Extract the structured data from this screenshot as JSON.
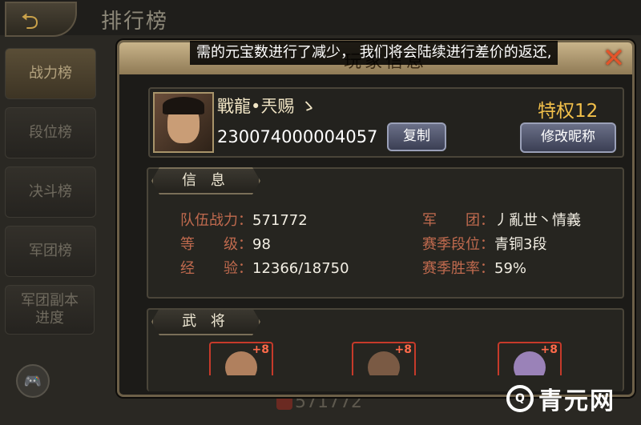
{
  "header": {
    "title": "排行榜"
  },
  "sidebar": {
    "tabs": [
      {
        "label": "战力榜"
      },
      {
        "label": "段位榜"
      },
      {
        "label": "决斗榜"
      },
      {
        "label": "军团榜"
      },
      {
        "label": "军团副本进度"
      }
    ]
  },
  "background": {
    "power_value": "571772"
  },
  "dialog": {
    "title": "玩家信息",
    "notice": "需的元宝数进行了减少， 我们将会陆续进行差价的返还,",
    "profile": {
      "name": "戰龍•兲赐 ゝ",
      "id": "230074000004057",
      "copy_label": "复制",
      "vip": "特权12",
      "rename_label": "修改昵称"
    },
    "info": {
      "section_label": "信 息",
      "rows": [
        {
          "label": "队伍战力",
          "value": "571772"
        },
        {
          "label": "等　　级",
          "value": "98"
        },
        {
          "label": "经　　验",
          "value": "12366/18750"
        },
        {
          "label": "军　　团",
          "value": "丿亂世丶情義"
        },
        {
          "label": "赛季段位",
          "value": "青铜3段"
        },
        {
          "label": "赛季胜率",
          "value": "59%"
        }
      ]
    },
    "heroes": {
      "section_label": "武 将",
      "cards": [
        {
          "badge": "+8",
          "tint": "#b0805e"
        },
        {
          "badge": "+8",
          "tint": "#7a5a44"
        },
        {
          "badge": "+8",
          "tint": "#9a82b8"
        }
      ]
    }
  },
  "watermark": {
    "text": "青元网",
    "logo": "Q"
  }
}
